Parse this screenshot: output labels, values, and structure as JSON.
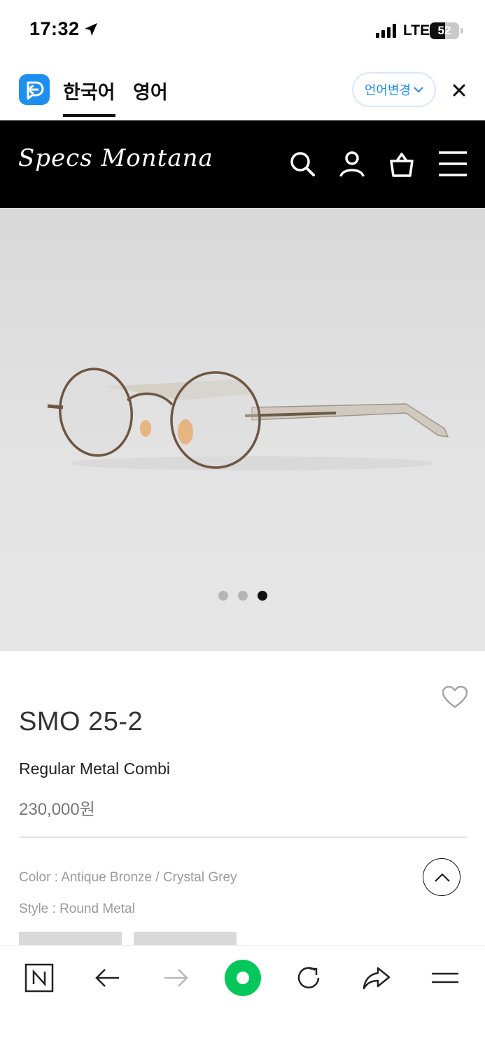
{
  "status_bar": {
    "time": "17:32",
    "network": "LTE",
    "battery_level": "52",
    "battery_fraction": 0.52
  },
  "translate_bar": {
    "tabs": [
      {
        "label": "한국어",
        "active": true
      },
      {
        "label": "영어",
        "active": false
      }
    ],
    "change_button": "언어변경"
  },
  "site_header": {
    "logo": "Specs Montana"
  },
  "gallery": {
    "slide_count": 3,
    "active_slide": 3
  },
  "product": {
    "name": "SMO 25-2",
    "subtitle": "Regular Metal Combi",
    "price": "230,000원",
    "color_line": "Color : Antique Bronze / Crystal Grey",
    "style_line": "Style : Round Metal"
  },
  "colors": {
    "translate_accent": "#1f8ef1",
    "header_bg": "#000000",
    "naver_green": "#03c75a"
  },
  "icons": {
    "header": [
      "search-icon",
      "user-icon",
      "shopping-bag-icon",
      "menu-icon"
    ],
    "browser_bar": [
      "naver-home-icon",
      "back-arrow-icon",
      "forward-arrow-icon",
      "naver-green-dot-icon",
      "refresh-icon",
      "share-icon",
      "menu-icon"
    ]
  }
}
